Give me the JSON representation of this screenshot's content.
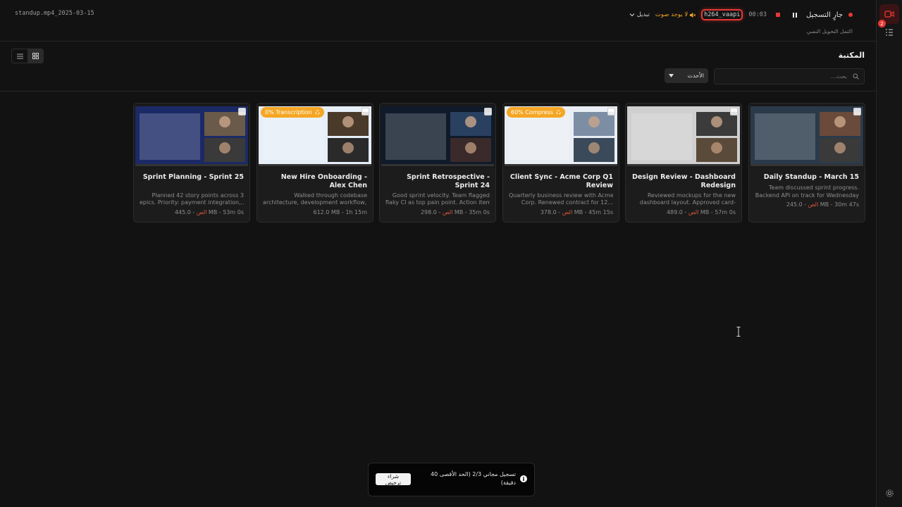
{
  "header": {
    "filename": "standup.mp4_2025-03-15",
    "recording_label": "جارٍ التسجيل",
    "timer": "00:03",
    "codec": "h264_vaapi",
    "no_audio": "لا يوجد صوت",
    "switch_label": "تبديل",
    "subline": "اكتمل التحويل النصي"
  },
  "library": {
    "title": "المكتبة",
    "search_placeholder": "بحث...",
    "sort_label": "الأحدث"
  },
  "cards": [
    {
      "title": "Daily Standup - March 15",
      "desc1": "Team discussed sprint progress.",
      "desc2": "Backend API on track for Wednesday",
      "size": "245.0 MB",
      "duration": "30m 47s",
      "lang": "الص",
      "badge": ""
    },
    {
      "title": "Design Review - Dashboard Redesign",
      "desc1": "Reviewed mockups for the new",
      "desc2": "dashboard layout. Approved card-",
      "size": "489.0 MB",
      "duration": "57m 0s",
      "lang": "الص",
      "badge": ""
    },
    {
      "title": "Client Sync - Acme Corp Q1 Review",
      "desc1": "Quarterly business review with Acme",
      "desc2": "Corp. Renewed contract for 12...",
      "size": "378.0 MB",
      "duration": "45m 15s",
      "lang": "الص",
      "badge": "60% Compress"
    },
    {
      "title": "Sprint Retrospective - Sprint 24",
      "desc1": "Good sprint velocity. Team flagged",
      "desc2": "flaky CI as top pain point. Action item...",
      "size": "298.0 MB",
      "duration": "35m 0s",
      "lang": "الص",
      "badge": ""
    },
    {
      "title": "New Hire Onboarding - Alex Chen",
      "desc1": "Walked through codebase",
      "desc2": "architecture, development workflow,...",
      "size": "612.0 MB",
      "duration": "1h 15m",
      "lang": "",
      "badge": "0% Transcription"
    },
    {
      "title": "Sprint Planning - Sprint 25",
      "desc1": "Planned 42 story points across 3",
      "desc2": "epics. Priority: payment integration,...",
      "size": "445.0 MB",
      "duration": "53m 0s",
      "lang": "الص",
      "badge": ""
    }
  ],
  "toast": {
    "text": "تسجيل مجاني 2/3 (الحد الأقصى 40 دقيقة)",
    "button": "شراء ترخيص"
  },
  "rail": {
    "badge_count": "2"
  },
  "colors": {
    "accent": "#e53935",
    "warning": "#f5a623",
    "lang": "#e0563a"
  }
}
